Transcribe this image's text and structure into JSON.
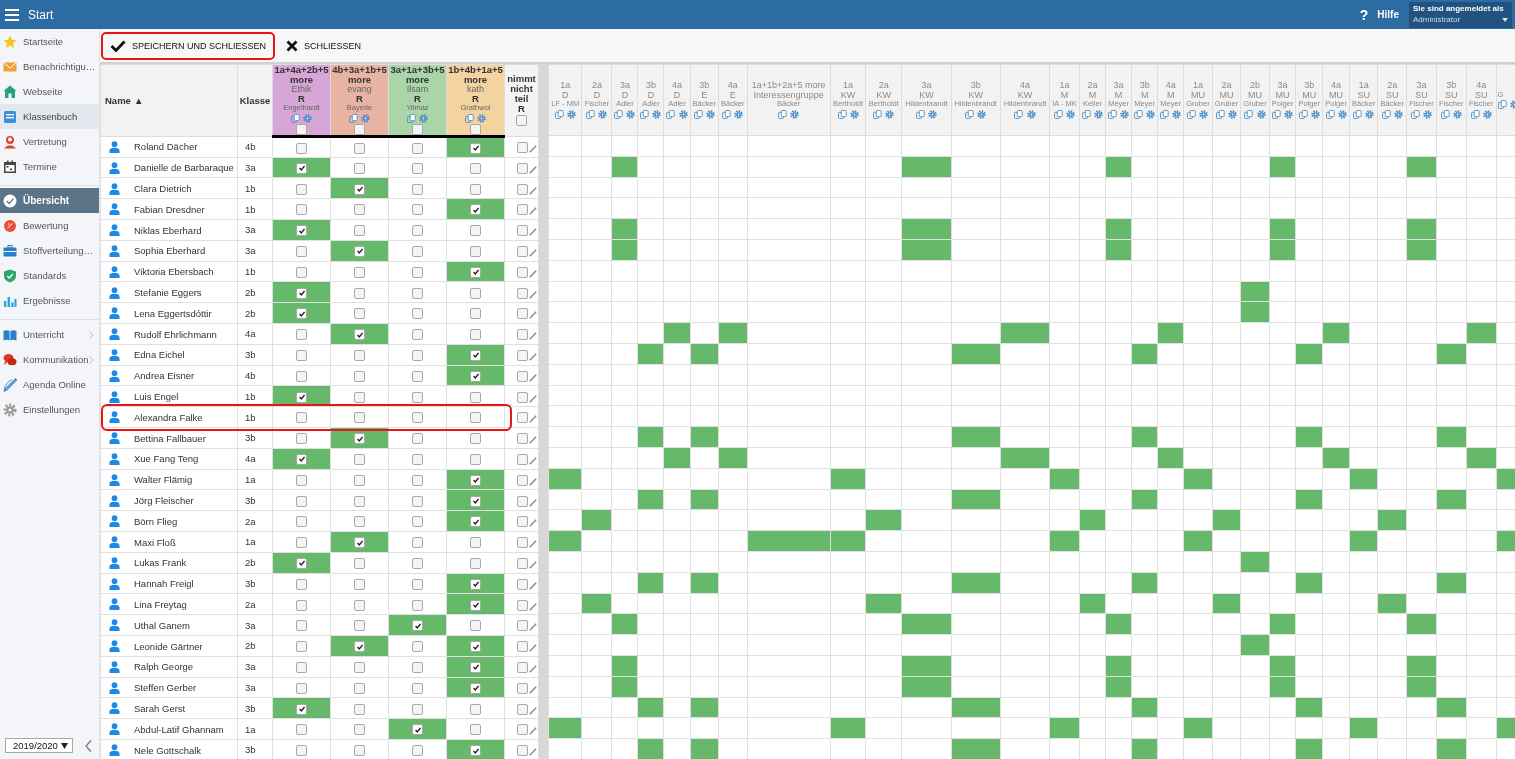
{
  "topbar": {
    "title": "Start",
    "help": "Hilfe",
    "help_icon": "?",
    "user_caption": "Sie sind angemeldet als",
    "user": "Administrator"
  },
  "sidebar": {
    "groups": [
      [
        {
          "label": "Startseite",
          "selected": false,
          "has_submenu": false
        },
        {
          "label": "Benachrichtigu…",
          "selected": false,
          "has_submenu": false
        },
        {
          "label": "Webseite",
          "selected": false,
          "has_submenu": false
        },
        {
          "label": "Klassenbuch",
          "selected": true,
          "has_submenu": false
        },
        {
          "label": "Vertretung",
          "selected": false,
          "has_submenu": false
        },
        {
          "label": "Termine",
          "selected": false,
          "has_submenu": false
        }
      ],
      [
        {
          "label": "Übersicht",
          "selected": true,
          "has_submenu": false
        },
        {
          "label": "Bewertung",
          "selected": false,
          "has_submenu": false
        },
        {
          "label": "Stoffverteilung…",
          "selected": false,
          "has_submenu": false
        },
        {
          "label": "Standards",
          "selected": false,
          "has_submenu": false
        },
        {
          "label": "Ergebnisse",
          "selected": false,
          "has_submenu": false
        }
      ],
      [
        {
          "label": "Unterricht",
          "selected": false,
          "has_submenu": true
        },
        {
          "label": "Kommunikation",
          "selected": false,
          "has_submenu": true
        },
        {
          "label": "Agenda Online",
          "selected": false,
          "has_submenu": false
        },
        {
          "label": "Einstellungen",
          "selected": false,
          "has_submenu": false
        }
      ]
    ],
    "year": "2019/2020"
  },
  "toolbar": [
    {
      "kind": "save",
      "label": "SPEICHERN UND SCHLIESSEN",
      "highlighted": true
    },
    {
      "kind": "close",
      "label": "SCHLIESSEN",
      "highlighted": false
    }
  ],
  "table": {
    "name_header": "Name",
    "sort_indicator": "▲",
    "class_header": "Klasse",
    "choice_columns": [
      {
        "classes": "1a+4a+2b+5 more",
        "subject": "Ethik",
        "type": "R",
        "teacher": "Engelhardt",
        "color": "#d7a6d6",
        "checked": false
      },
      {
        "classes": "4b+3a+1b+5 more",
        "subject": "evang",
        "type": "R",
        "teacher": "Bayerle",
        "color": "#e9b3a3",
        "checked": false
      },
      {
        "classes": "3a+1a+3b+5 more",
        "subject": "Ilsam",
        "type": "R",
        "teacher": "Yilmaz",
        "color": "#a9d5a9",
        "checked": false
      },
      {
        "classes": "1b+4b+1a+5 more",
        "subject": "kath",
        "type": "R",
        "teacher": "Grathwol",
        "color": "#f4d3a1",
        "checked": false
      }
    ],
    "absent_column": {
      "label": "nimmt nicht teil",
      "type": "R",
      "checked": false
    },
    "course_columns": [
      {
        "classes": "1a",
        "subject": "D",
        "teacher": "LF - MM"
      },
      {
        "classes": "2a",
        "subject": "D",
        "teacher": "Fischer"
      },
      {
        "classes": "3a",
        "subject": "D",
        "teacher": "Adler"
      },
      {
        "classes": "3b",
        "subject": "D",
        "teacher": "Adler"
      },
      {
        "classes": "4a",
        "subject": "D",
        "teacher": "Adler"
      },
      {
        "classes": "3b",
        "subject": "E",
        "teacher": "Bäcker"
      },
      {
        "classes": "4a",
        "subject": "E",
        "teacher": "Bäcker"
      },
      {
        "classes": "1a+1b+2a+5 more",
        "subject": "Interessengruppe",
        "teacher": "Bäcker"
      },
      {
        "classes": "1a",
        "subject": "KW",
        "teacher": "Bertholdt"
      },
      {
        "classes": "2a",
        "subject": "KW",
        "teacher": "Bertholdt"
      },
      {
        "classes": "3a",
        "subject": "KW",
        "teacher": "Hildenbrandt"
      },
      {
        "classes": "3b",
        "subject": "KW",
        "teacher": "Hildenbrandt"
      },
      {
        "classes": "4a",
        "subject": "KW",
        "teacher": "Hildenbrandt"
      },
      {
        "classes": "1a",
        "subject": "M",
        "teacher": "IA - MK"
      },
      {
        "classes": "2a",
        "subject": "M",
        "teacher": "Keller"
      },
      {
        "classes": "3a",
        "subject": "M",
        "teacher": "Meyer"
      },
      {
        "classes": "3b",
        "subject": "M",
        "teacher": "Meyer"
      },
      {
        "classes": "4a",
        "subject": "M",
        "teacher": "Meyer"
      },
      {
        "classes": "1a",
        "subject": "MU",
        "teacher": "Gruber"
      },
      {
        "classes": "2a",
        "subject": "MU",
        "teacher": "Gruber"
      },
      {
        "classes": "2b",
        "subject": "MU",
        "teacher": "Gruber"
      },
      {
        "classes": "3a",
        "subject": "MU",
        "teacher": "Polger"
      },
      {
        "classes": "3b",
        "subject": "MU",
        "teacher": "Polger"
      },
      {
        "classes": "4a",
        "subject": "MU",
        "teacher": "Polger"
      },
      {
        "classes": "1a",
        "subject": "SU",
        "teacher": "Bäcker"
      },
      {
        "classes": "2a",
        "subject": "SU",
        "teacher": "Bäcker"
      },
      {
        "classes": "3a",
        "subject": "SU",
        "teacher": "Fischer"
      },
      {
        "classes": "3b",
        "subject": "SU",
        "teacher": "Fischer"
      },
      {
        "classes": "4a",
        "subject": "SU",
        "teacher": "Fischer"
      },
      {
        "teacher": "G"
      }
    ],
    "rows": [
      {
        "name": "Roland Dächer",
        "class": "4b",
        "choices": [
          false,
          false,
          false,
          true
        ],
        "not_participating": false,
        "highlighted": false,
        "courses": [
          false,
          false,
          false,
          false,
          false,
          false,
          false,
          false,
          false,
          false,
          false,
          false,
          false,
          false,
          false,
          false,
          false,
          false,
          false,
          false,
          false,
          false,
          false,
          false,
          false,
          false,
          false,
          false,
          false,
          false
        ]
      },
      {
        "name": "Danielle de Barbaraque",
        "class": "3a",
        "choices": [
          true,
          false,
          false,
          false
        ],
        "not_participating": false,
        "highlighted": false,
        "courses": [
          false,
          false,
          true,
          false,
          false,
          false,
          false,
          false,
          false,
          false,
          true,
          false,
          false,
          false,
          false,
          true,
          false,
          false,
          false,
          false,
          false,
          true,
          false,
          false,
          false,
          false,
          true,
          false,
          false,
          false
        ]
      },
      {
        "name": "Clara Dietrich",
        "class": "1b",
        "choices": [
          false,
          true,
          false,
          false
        ],
        "not_participating": false,
        "highlighted": false,
        "courses": [
          false,
          false,
          false,
          false,
          false,
          false,
          false,
          false,
          false,
          false,
          false,
          false,
          false,
          false,
          false,
          false,
          false,
          false,
          false,
          false,
          false,
          false,
          false,
          false,
          false,
          false,
          false,
          false,
          false,
          false
        ]
      },
      {
        "name": "Fabian Dresdner",
        "class": "1b",
        "choices": [
          false,
          false,
          false,
          true
        ],
        "not_participating": false,
        "highlighted": false,
        "courses": [
          false,
          false,
          false,
          false,
          false,
          false,
          false,
          false,
          false,
          false,
          false,
          false,
          false,
          false,
          false,
          false,
          false,
          false,
          false,
          false,
          false,
          false,
          false,
          false,
          false,
          false,
          false,
          false,
          false,
          false
        ]
      },
      {
        "name": "Niklas Eberhard",
        "class": "3a",
        "choices": [
          true,
          false,
          false,
          false
        ],
        "not_participating": false,
        "highlighted": false,
        "courses": [
          false,
          false,
          true,
          false,
          false,
          false,
          false,
          false,
          false,
          false,
          true,
          false,
          false,
          false,
          false,
          true,
          false,
          false,
          false,
          false,
          false,
          true,
          false,
          false,
          false,
          false,
          true,
          false,
          false,
          false
        ]
      },
      {
        "name": "Sophia Eberhard",
        "class": "3a",
        "choices": [
          false,
          true,
          false,
          false
        ],
        "not_participating": false,
        "highlighted": false,
        "courses": [
          false,
          false,
          true,
          false,
          false,
          false,
          false,
          false,
          false,
          false,
          true,
          false,
          false,
          false,
          false,
          true,
          false,
          false,
          false,
          false,
          false,
          true,
          false,
          false,
          false,
          false,
          true,
          false,
          false,
          false
        ]
      },
      {
        "name": "Viktoria Ebersbach",
        "class": "1b",
        "choices": [
          false,
          false,
          false,
          true
        ],
        "not_participating": false,
        "highlighted": false,
        "courses": [
          false,
          false,
          false,
          false,
          false,
          false,
          false,
          false,
          false,
          false,
          false,
          false,
          false,
          false,
          false,
          false,
          false,
          false,
          false,
          false,
          false,
          false,
          false,
          false,
          false,
          false,
          false,
          false,
          false,
          false
        ]
      },
      {
        "name": "Stefanie Eggers",
        "class": "2b",
        "choices": [
          true,
          false,
          false,
          false
        ],
        "not_participating": false,
        "highlighted": false,
        "courses": [
          false,
          false,
          false,
          false,
          false,
          false,
          false,
          false,
          false,
          false,
          false,
          false,
          false,
          false,
          false,
          false,
          false,
          false,
          false,
          false,
          true,
          false,
          false,
          false,
          false,
          false,
          false,
          false,
          false,
          false
        ]
      },
      {
        "name": "Lena Eggertsdóttir",
        "class": "2b",
        "choices": [
          true,
          false,
          false,
          false
        ],
        "not_participating": false,
        "highlighted": false,
        "courses": [
          false,
          false,
          false,
          false,
          false,
          false,
          false,
          false,
          false,
          false,
          false,
          false,
          false,
          false,
          false,
          false,
          false,
          false,
          false,
          false,
          true,
          false,
          false,
          false,
          false,
          false,
          false,
          false,
          false,
          false
        ]
      },
      {
        "name": "Rudolf Ehrlichmann",
        "class": "4a",
        "choices": [
          false,
          true,
          false,
          false
        ],
        "not_participating": false,
        "highlighted": false,
        "courses": [
          false,
          false,
          false,
          false,
          true,
          false,
          true,
          false,
          false,
          false,
          false,
          false,
          true,
          false,
          false,
          false,
          false,
          true,
          false,
          false,
          false,
          false,
          false,
          true,
          false,
          false,
          false,
          false,
          true,
          false
        ]
      },
      {
        "name": "Edna Eichel",
        "class": "3b",
        "choices": [
          false,
          false,
          false,
          true
        ],
        "not_participating": false,
        "highlighted": false,
        "courses": [
          false,
          false,
          false,
          true,
          false,
          true,
          false,
          false,
          false,
          false,
          false,
          true,
          false,
          false,
          false,
          false,
          true,
          false,
          false,
          false,
          false,
          false,
          true,
          false,
          false,
          false,
          false,
          true,
          false,
          false
        ]
      },
      {
        "name": "Andrea Eisner",
        "class": "4b",
        "choices": [
          false,
          false,
          false,
          true
        ],
        "not_participating": false,
        "highlighted": false,
        "courses": [
          false,
          false,
          false,
          false,
          false,
          false,
          false,
          false,
          false,
          false,
          false,
          false,
          false,
          false,
          false,
          false,
          false,
          false,
          false,
          false,
          false,
          false,
          false,
          false,
          false,
          false,
          false,
          false,
          false,
          false
        ]
      },
      {
        "name": "Luis Engel",
        "class": "1b",
        "choices": [
          true,
          false,
          false,
          false
        ],
        "not_participating": false,
        "highlighted": false,
        "courses": [
          false,
          false,
          false,
          false,
          false,
          false,
          false,
          false,
          false,
          false,
          false,
          false,
          false,
          false,
          false,
          false,
          false,
          false,
          false,
          false,
          false,
          false,
          false,
          false,
          false,
          false,
          false,
          false,
          false,
          false
        ]
      },
      {
        "name": "Alexandra Falke",
        "class": "1b",
        "choices": [
          false,
          false,
          false,
          false
        ],
        "not_participating": false,
        "highlighted": true,
        "courses": [
          false,
          false,
          false,
          false,
          false,
          false,
          false,
          false,
          false,
          false,
          false,
          false,
          false,
          false,
          false,
          false,
          false,
          false,
          false,
          false,
          false,
          false,
          false,
          false,
          false,
          false,
          false,
          false,
          false,
          false
        ]
      },
      {
        "name": "Bettina Fallbauer",
        "class": "3b",
        "choices": [
          false,
          true,
          false,
          false
        ],
        "not_participating": false,
        "highlighted": false,
        "courses": [
          false,
          false,
          false,
          true,
          false,
          true,
          false,
          false,
          false,
          false,
          false,
          true,
          false,
          false,
          false,
          false,
          true,
          false,
          false,
          false,
          false,
          false,
          true,
          false,
          false,
          false,
          false,
          true,
          false,
          false
        ]
      },
      {
        "name": "Xue Fang Teng",
        "class": "4a",
        "choices": [
          true,
          false,
          false,
          false
        ],
        "not_participating": false,
        "highlighted": false,
        "courses": [
          false,
          false,
          false,
          false,
          true,
          false,
          true,
          false,
          false,
          false,
          false,
          false,
          true,
          false,
          false,
          false,
          false,
          true,
          false,
          false,
          false,
          false,
          false,
          true,
          false,
          false,
          false,
          false,
          true,
          false
        ]
      },
      {
        "name": "Walter Flämig",
        "class": "1a",
        "choices": [
          false,
          false,
          false,
          true
        ],
        "not_participating": false,
        "highlighted": false,
        "courses": [
          true,
          false,
          false,
          false,
          false,
          false,
          false,
          false,
          true,
          false,
          false,
          false,
          false,
          true,
          false,
          false,
          false,
          false,
          true,
          false,
          false,
          false,
          false,
          false,
          true,
          false,
          false,
          false,
          false,
          true
        ]
      },
      {
        "name": "Jörg Fleischer",
        "class": "3b",
        "choices": [
          false,
          false,
          false,
          true
        ],
        "not_participating": false,
        "highlighted": false,
        "courses": [
          false,
          false,
          false,
          true,
          false,
          true,
          false,
          false,
          false,
          false,
          false,
          true,
          false,
          false,
          false,
          false,
          true,
          false,
          false,
          false,
          false,
          false,
          true,
          false,
          false,
          false,
          false,
          true,
          false,
          false
        ]
      },
      {
        "name": "Börn Flieg",
        "class": "2a",
        "choices": [
          false,
          false,
          false,
          true
        ],
        "not_participating": false,
        "highlighted": false,
        "courses": [
          false,
          true,
          false,
          false,
          false,
          false,
          false,
          false,
          false,
          true,
          false,
          false,
          false,
          false,
          true,
          false,
          false,
          false,
          false,
          true,
          false,
          false,
          false,
          false,
          false,
          true,
          false,
          false,
          false,
          false
        ]
      },
      {
        "name": "Maxi Floß",
        "class": "1a",
        "choices": [
          false,
          true,
          false,
          false
        ],
        "not_participating": false,
        "highlighted": false,
        "courses": [
          true,
          false,
          false,
          false,
          false,
          false,
          false,
          true,
          true,
          false,
          false,
          false,
          false,
          true,
          false,
          false,
          false,
          false,
          true,
          false,
          false,
          false,
          false,
          false,
          true,
          false,
          false,
          false,
          false,
          true
        ]
      },
      {
        "name": "Lukas Frank",
        "class": "2b",
        "choices": [
          true,
          false,
          false,
          false
        ],
        "not_participating": false,
        "highlighted": false,
        "courses": [
          false,
          false,
          false,
          false,
          false,
          false,
          false,
          false,
          false,
          false,
          false,
          false,
          false,
          false,
          false,
          false,
          false,
          false,
          false,
          false,
          true,
          false,
          false,
          false,
          false,
          false,
          false,
          false,
          false,
          false
        ]
      },
      {
        "name": "Hannah Freigl",
        "class": "3b",
        "choices": [
          false,
          false,
          false,
          true
        ],
        "not_participating": false,
        "highlighted": false,
        "courses": [
          false,
          false,
          false,
          true,
          false,
          true,
          false,
          false,
          false,
          false,
          false,
          true,
          false,
          false,
          false,
          false,
          true,
          false,
          false,
          false,
          false,
          false,
          true,
          false,
          false,
          false,
          false,
          true,
          false,
          false
        ]
      },
      {
        "name": "Lina Freytag",
        "class": "2a",
        "choices": [
          false,
          false,
          false,
          true
        ],
        "not_participating": false,
        "highlighted": false,
        "courses": [
          false,
          true,
          false,
          false,
          false,
          false,
          false,
          false,
          false,
          true,
          false,
          false,
          false,
          false,
          true,
          false,
          false,
          false,
          false,
          true,
          false,
          false,
          false,
          false,
          false,
          true,
          false,
          false,
          false,
          false
        ]
      },
      {
        "name": "Uthal Ganem",
        "class": "3a",
        "choices": [
          false,
          false,
          true,
          false
        ],
        "not_participating": false,
        "highlighted": false,
        "courses": [
          false,
          false,
          true,
          false,
          false,
          false,
          false,
          false,
          false,
          false,
          true,
          false,
          false,
          false,
          false,
          true,
          false,
          false,
          false,
          false,
          false,
          true,
          false,
          false,
          false,
          false,
          true,
          false,
          false,
          false
        ]
      },
      {
        "name": "Leonide Gärtner",
        "class": "2b",
        "choices": [
          false,
          true,
          false,
          true
        ],
        "not_participating": false,
        "highlighted": false,
        "courses": [
          false,
          false,
          false,
          false,
          false,
          false,
          false,
          false,
          false,
          false,
          false,
          false,
          false,
          false,
          false,
          false,
          false,
          false,
          false,
          false,
          true,
          false,
          false,
          false,
          false,
          false,
          false,
          false,
          false,
          false
        ]
      },
      {
        "name": "Ralph George",
        "class": "3a",
        "choices": [
          false,
          false,
          false,
          true
        ],
        "not_participating": false,
        "highlighted": false,
        "courses": [
          false,
          false,
          true,
          false,
          false,
          false,
          false,
          false,
          false,
          false,
          true,
          false,
          false,
          false,
          false,
          true,
          false,
          false,
          false,
          false,
          false,
          true,
          false,
          false,
          false,
          false,
          true,
          false,
          false,
          false
        ]
      },
      {
        "name": "Steffen Gerber",
        "class": "3a",
        "choices": [
          false,
          false,
          false,
          true
        ],
        "not_participating": false,
        "highlighted": false,
        "courses": [
          false,
          false,
          true,
          false,
          false,
          false,
          false,
          false,
          false,
          false,
          true,
          false,
          false,
          false,
          false,
          true,
          false,
          false,
          false,
          false,
          false,
          true,
          false,
          false,
          false,
          false,
          true,
          false,
          false,
          false
        ]
      },
      {
        "name": "Sarah Gerst",
        "class": "3b",
        "choices": [
          true,
          false,
          false,
          false
        ],
        "not_participating": false,
        "highlighted": false,
        "courses": [
          false,
          false,
          false,
          true,
          false,
          true,
          false,
          false,
          false,
          false,
          false,
          true,
          false,
          false,
          false,
          false,
          true,
          false,
          false,
          false,
          false,
          false,
          true,
          false,
          false,
          false,
          false,
          true,
          false,
          false
        ]
      },
      {
        "name": "Abdul-Latif Ghannam",
        "class": "1a",
        "choices": [
          false,
          false,
          true,
          false
        ],
        "not_participating": false,
        "highlighted": false,
        "courses": [
          true,
          false,
          false,
          false,
          false,
          false,
          false,
          false,
          true,
          false,
          false,
          false,
          false,
          true,
          false,
          false,
          false,
          false,
          true,
          false,
          false,
          false,
          false,
          false,
          true,
          false,
          false,
          false,
          false,
          true
        ]
      },
      {
        "name": "Nele Gottschalk",
        "class": "3b",
        "choices": [
          false,
          false,
          false,
          true
        ],
        "not_participating": false,
        "highlighted": false,
        "courses": [
          false,
          false,
          false,
          true,
          false,
          true,
          false,
          false,
          false,
          false,
          false,
          true,
          false,
          false,
          false,
          false,
          true,
          false,
          false,
          false,
          false,
          false,
          true,
          false,
          false,
          false,
          false,
          true,
          false,
          false
        ]
      }
    ]
  }
}
